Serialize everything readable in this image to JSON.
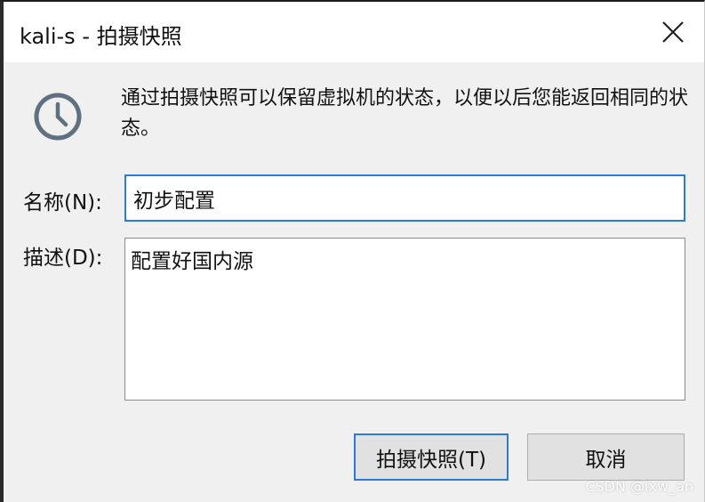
{
  "window": {
    "title": "kali-s - 拍摄快照"
  },
  "info": {
    "icon": "clock-icon",
    "text": "通过拍摄快照可以保留虚拟机的状态，以便以后您能返回相同的状态。"
  },
  "form": {
    "name_label": "名称(N):",
    "name_value": "初步配置",
    "description_label": "描述(D):",
    "description_value": "配置好国内源"
  },
  "buttons": {
    "take_snapshot": "拍摄快照(T)",
    "cancel": "取消"
  },
  "watermark": "CSDN @lxw_an",
  "colors": {
    "focus_border": "#2a7bd4",
    "dialog_background": "#f0f0f0",
    "button_background": "#e1e1e1"
  }
}
